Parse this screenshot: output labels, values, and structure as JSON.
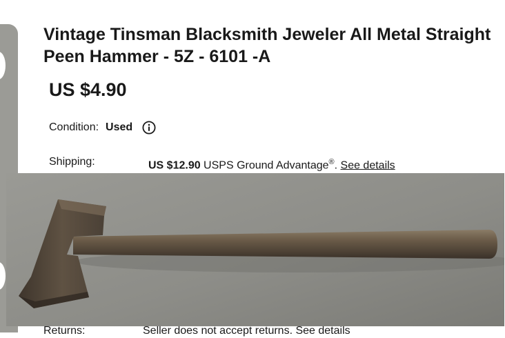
{
  "listing": {
    "title": "Vintage Tinsman Blacksmith Jeweler All Metal Straight Peen Hammer - 5Z - 6101 -A",
    "price": "US $4.90"
  },
  "condition": {
    "label": "Condition:",
    "value": "Used",
    "icon": "info-icon"
  },
  "shipping": {
    "label": "Shipping:",
    "cost": "US $12.90",
    "service": " USPS Ground Advantage",
    "registered_mark": "®",
    "separator": ". ",
    "details_link": "See details"
  },
  "returns": {
    "label": "Returns:",
    "value": "Seller does not accept returns. See details"
  },
  "photo": {
    "subject": "hammer",
    "background_color": "#8d8d88",
    "metal_color": "#5a4d3d"
  }
}
